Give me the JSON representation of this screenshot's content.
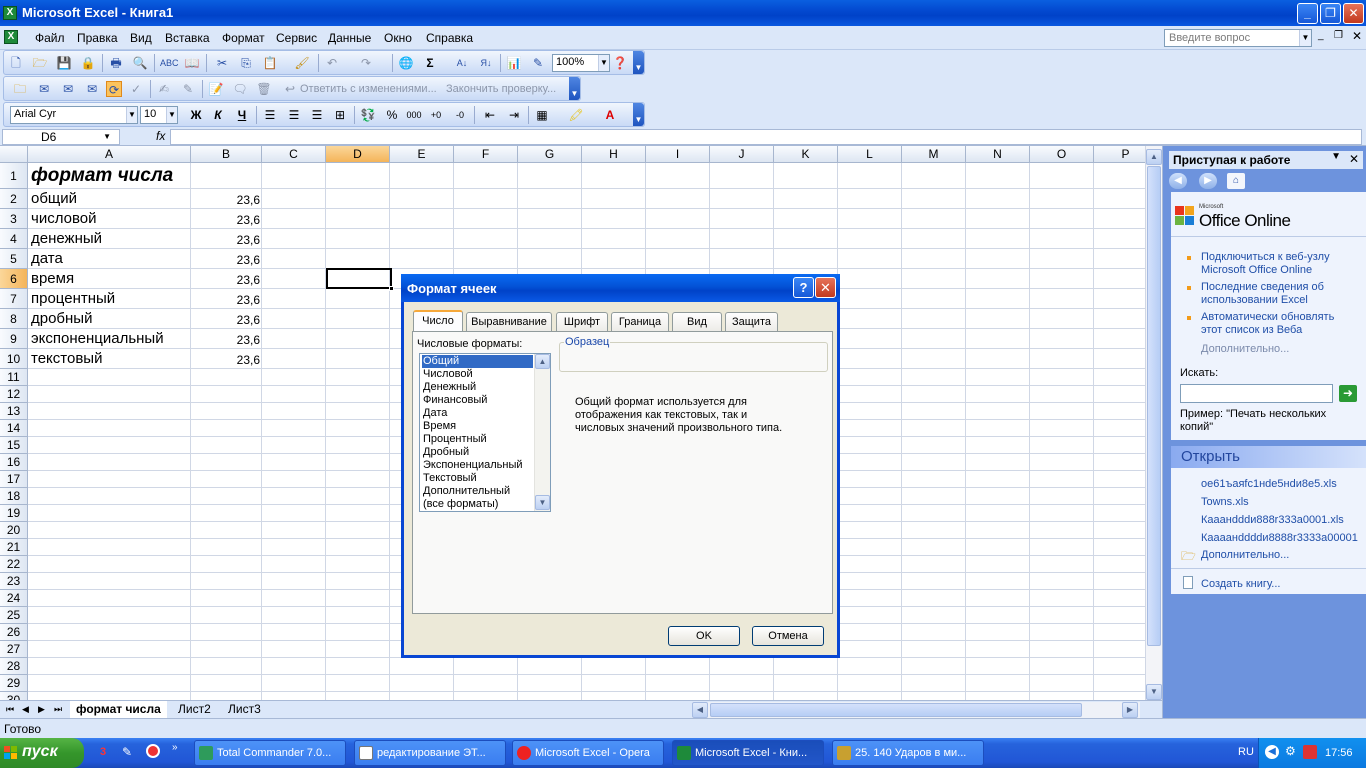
{
  "window": {
    "title": "Microsoft Excel - Книга1"
  },
  "menu": [
    "Файл",
    "Правка",
    "Вид",
    "Вставка",
    "Формат",
    "Сервис",
    "Данные",
    "Окно",
    "Справка"
  ],
  "help_placeholder": "Введите вопрос",
  "toolbar": {
    "zoom": "100%",
    "review_reply": "Ответить с изменениями...",
    "review_end": "Закончить проверку...",
    "font_name": "Arial Cyr",
    "font_size": "10",
    "bold": "Ж",
    "italic": "К",
    "underline": "Ч",
    "percent": "%",
    "thousands": "000"
  },
  "formula_bar": {
    "cell_ref": "D6",
    "fx": "fx"
  },
  "grid": {
    "columns": [
      "A",
      "B",
      "C",
      "D",
      "E",
      "F",
      "G",
      "H",
      "I",
      "J",
      "K",
      "L",
      "M",
      "N",
      "O",
      "P"
    ],
    "rows": [
      "1",
      "2",
      "3",
      "4",
      "5",
      "6",
      "7",
      "8",
      "9",
      "10",
      "11",
      "12",
      "13",
      "14",
      "15",
      "16",
      "17",
      "18",
      "19",
      "20",
      "21",
      "22",
      "23",
      "24",
      "25",
      "26",
      "27",
      "28",
      "29",
      "30"
    ],
    "cells": [
      {
        "row": 1,
        "a": "формат числа",
        "b": ""
      },
      {
        "row": 2,
        "a": "общий",
        "b": "23,6"
      },
      {
        "row": 3,
        "a": "числовой",
        "b": "23,6"
      },
      {
        "row": 4,
        "a": "денежный",
        "b": "23,6"
      },
      {
        "row": 5,
        "a": "дата",
        "b": "23,6"
      },
      {
        "row": 6,
        "a": "время",
        "b": "23,6"
      },
      {
        "row": 7,
        "a": "процентный",
        "b": "23,6"
      },
      {
        "row": 8,
        "a": "дробный",
        "b": "23,6"
      },
      {
        "row": 9,
        "a": "экспоненциальный",
        "b": "23,6"
      },
      {
        "row": 10,
        "a": "текстовый",
        "b": "23,6"
      }
    ]
  },
  "sheets": [
    "формат числа",
    "Лист2",
    "Лист3"
  ],
  "status": "Готово",
  "task_pane": {
    "title": "Приступая к работе",
    "office_brand_small": "Microsoft",
    "office_brand": "Office Online",
    "links": [
      "Подключиться к веб-узлу Microsoft Office Online",
      "Последние сведения об использовании Excel",
      "Автоматически обновлять этот список из Веба"
    ],
    "more": "Дополнительно...",
    "search_label": "Искать:",
    "example": "Пример:  \"Печать нескольких копий\"",
    "open_header": "Открыть",
    "files": [
      "oe61ъaяfc1нde5нdи8e5.xls",
      "Towns.xls",
      "Кaaанdddи888r333a0001.xls",
      "Кaaaанddddи8888r3333a00001"
    ],
    "open_more": "Дополнительно...",
    "new_book": "Создать книгу..."
  },
  "dialog": {
    "title": "Формат ячеек",
    "tabs": [
      "Число",
      "Выравнивание",
      "Шрифт",
      "Граница",
      "Вид",
      "Защита"
    ],
    "formats_label": "Числовые форматы:",
    "formats": [
      "Общий",
      "Числовой",
      "Денежный",
      "Финансовый",
      "Дата",
      "Время",
      "Процентный",
      "Дробный",
      "Экспоненциальный",
      "Текстовый",
      "Дополнительный",
      "(все форматы)"
    ],
    "sample_label": "Образец",
    "description": "Общий формат используется для отображения как текстовых, так и числовых значений произвольного типа.",
    "ok": "OK",
    "cancel": "Отмена"
  },
  "taskbar": {
    "start": "пуск",
    "tasks": [
      "Total Commander 7.0...",
      "редактирование ЭТ...",
      "Microsoft Excel - Opera",
      "Microsoft Excel - Кни...",
      "25. 140 Ударов в ми..."
    ],
    "lang": "RU",
    "time": "17:56"
  }
}
